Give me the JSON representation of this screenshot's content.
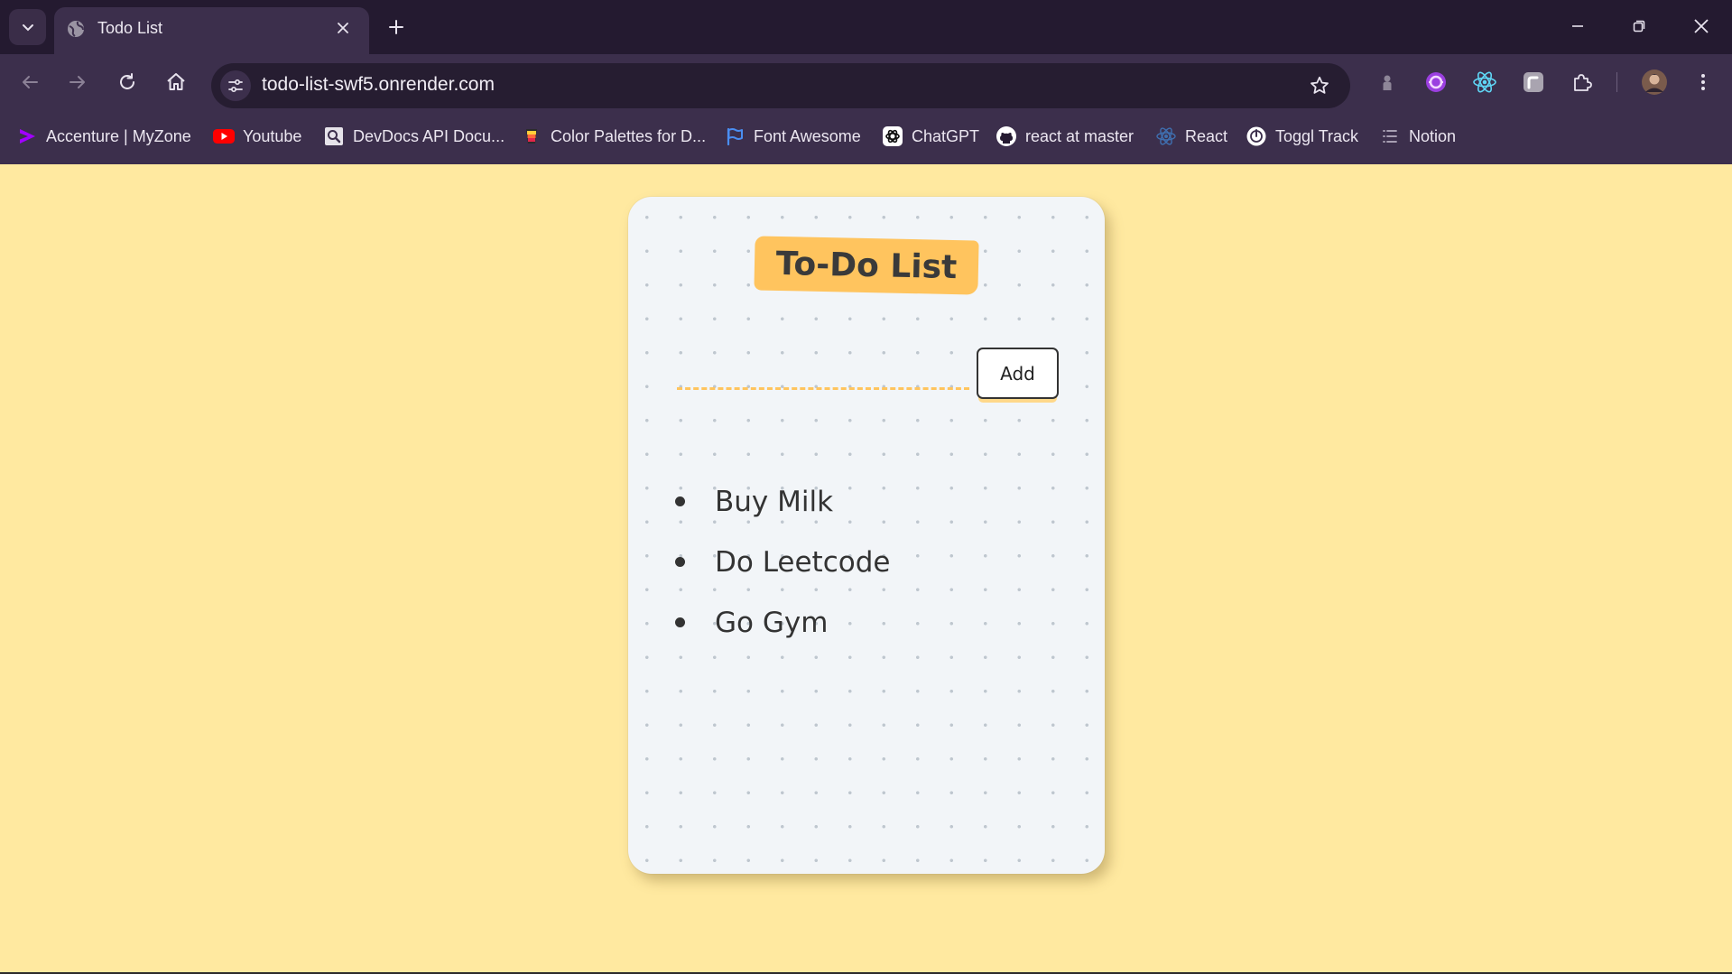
{
  "browser": {
    "tab": {
      "title": "Todo List"
    },
    "url": "todo-list-swf5.onrender.com",
    "bookmarks": [
      {
        "label": "Accenture | MyZone",
        "icon": "accenture-icon"
      },
      {
        "label": "Youtube",
        "icon": "youtube-icon"
      },
      {
        "label": "DevDocs API Docu...",
        "icon": "devdocs-icon"
      },
      {
        "label": "Color Palettes for D...",
        "icon": "color-palettes-icon"
      },
      {
        "label": "Font Awesome",
        "icon": "flag-icon"
      },
      {
        "label": "ChatGPT",
        "icon": "chatgpt-icon"
      },
      {
        "label": "react at master",
        "icon": "github-icon"
      },
      {
        "label": "React",
        "icon": "react-icon"
      },
      {
        "label": "Toggl Track",
        "icon": "toggl-icon"
      },
      {
        "label": "Notion",
        "icon": "list-icon"
      }
    ]
  },
  "app": {
    "title": "To-Do List",
    "input": {
      "value": "",
      "placeholder": ""
    },
    "add_label": "Add",
    "items": [
      "Buy Milk",
      "Do Leetcode",
      "Go Gym"
    ]
  },
  "colors": {
    "page_background": "#ffe9a0",
    "card_background": "#f2f5f8",
    "accent": "#ffc45e",
    "chrome_dark": "#241a30",
    "chrome": "#3c2f4c"
  }
}
